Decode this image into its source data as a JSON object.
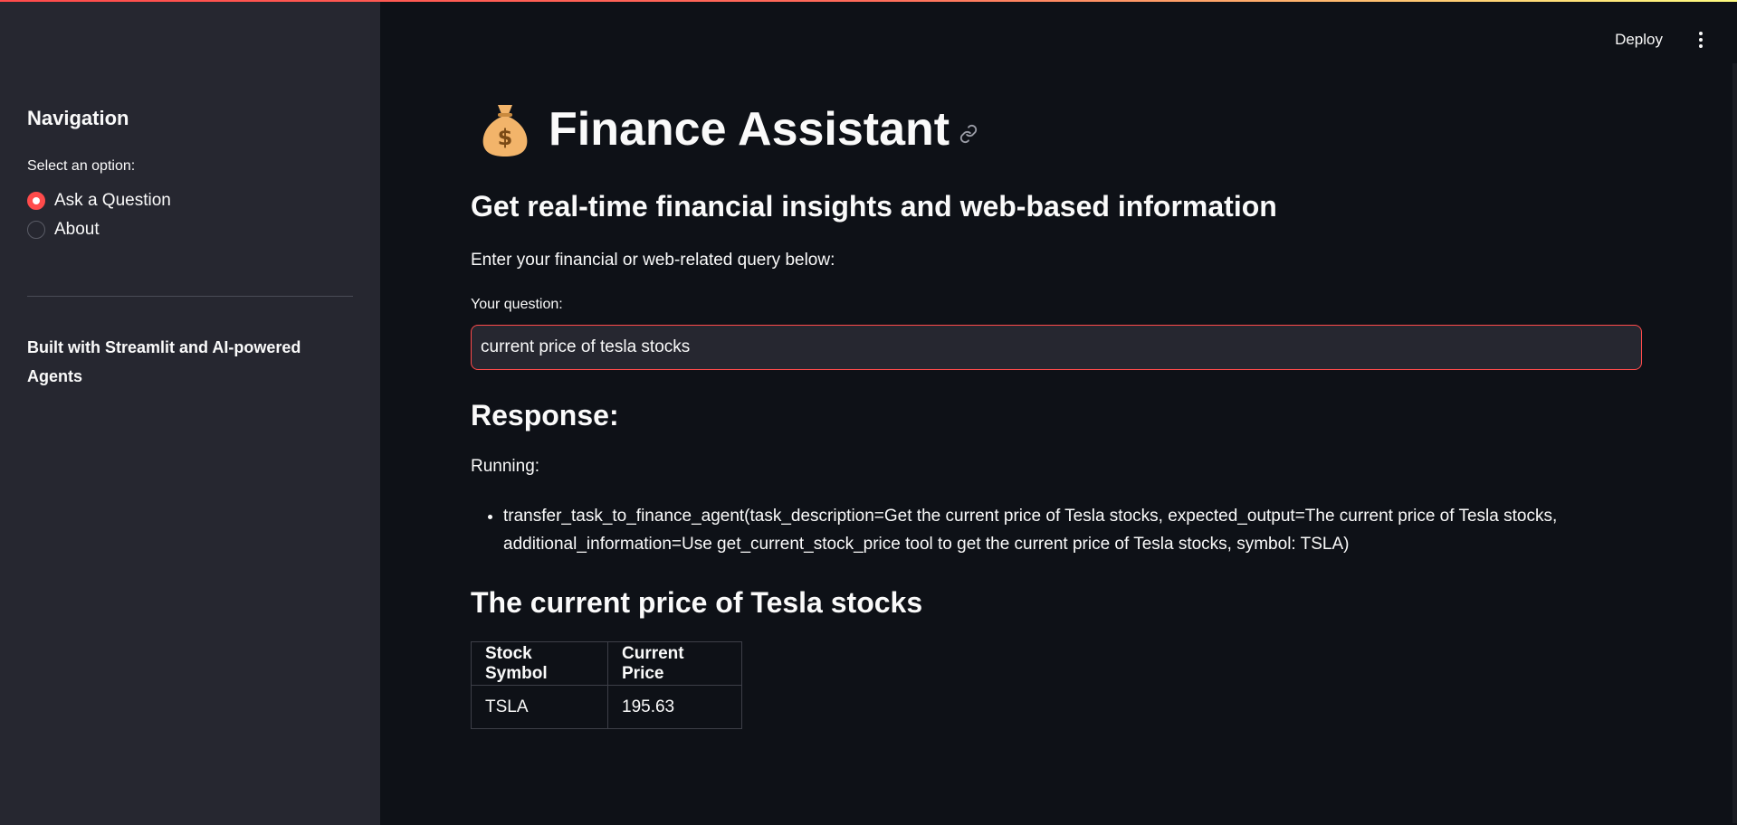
{
  "header": {
    "deploy_label": "Deploy",
    "menu_icon": "kebab-menu-icon"
  },
  "sidebar": {
    "heading": "Navigation",
    "radio_label": "Select an option:",
    "options": [
      {
        "label": "Ask a Question",
        "selected": true
      },
      {
        "label": "About",
        "selected": false
      }
    ],
    "footer": "Built with Streamlit and AI-powered Agents"
  },
  "main": {
    "title_icon": "money-bag-icon",
    "title": "Finance Assistant",
    "subtitle": "Get real-time financial insights and web-based information",
    "intro": "Enter your financial or web-related query below:",
    "input": {
      "label": "Your question:",
      "value": "current price of tesla stocks"
    },
    "response_heading": "Response:",
    "running_label": "Running:",
    "tasks": [
      "transfer_task_to_finance_agent(task_description=Get the current price of Tesla stocks, expected_output=The current price of Tesla stocks, additional_information=Use get_current_stock_price tool to get the current price of Tesla stocks, symbol: TSLA)"
    ],
    "result_heading": "The current price of Tesla stocks",
    "table": {
      "headers": [
        "Stock Symbol",
        "Current Price"
      ],
      "rows": [
        [
          "TSLA",
          "195.63"
        ]
      ]
    }
  },
  "colors": {
    "accent": "#ff4b4b",
    "background": "#0e1117",
    "sidebar": "#262730",
    "text": "#fafafa"
  }
}
